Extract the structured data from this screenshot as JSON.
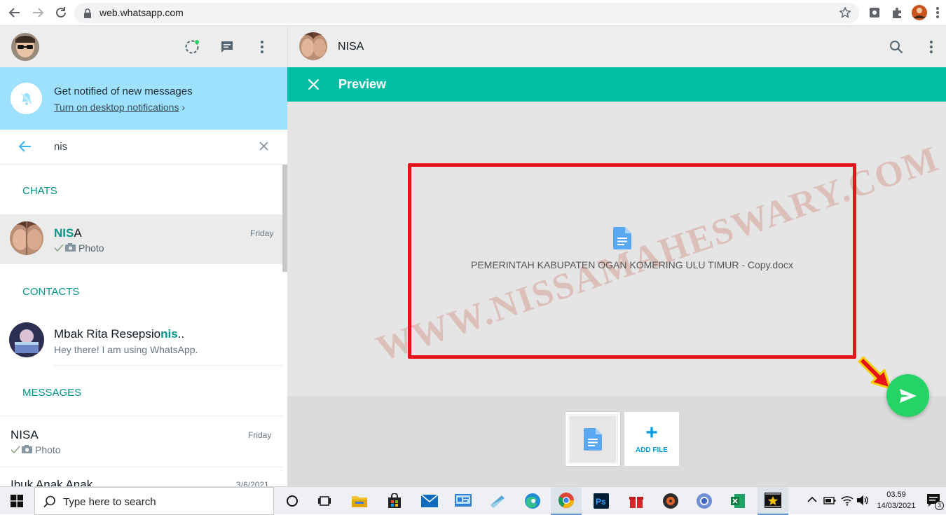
{
  "browser": {
    "url": "web.whatsapp.com"
  },
  "left_panel": {
    "notification": {
      "title": "Get notified of new messages",
      "link": "Turn on desktop notifications",
      "chevron": "›"
    },
    "search": {
      "query": "nis"
    },
    "sections": {
      "chats": "CHATS",
      "contacts": "CONTACTS",
      "messages": "MESSAGES"
    },
    "chat_result": {
      "name_match": "NIS",
      "name_rest": "A",
      "time": "Friday",
      "preview": "Photo"
    },
    "contact_result": {
      "name_prefix": "Mbak Rita Resepsio",
      "name_match": "nis",
      "name_suffix": "..",
      "status": "Hey there! I am using WhatsApp."
    },
    "message_results": [
      {
        "name": "NISA",
        "time": "Friday",
        "preview": "Photo"
      },
      {
        "name": "Ibuk Anak Anak",
        "time": "3/6/2021"
      }
    ]
  },
  "right_panel": {
    "header": {
      "contact_name": "NISA"
    },
    "preview": {
      "title": "Preview",
      "document_name": "PEMERINTAH KABUPATEN OGAN KOMERING ULU TIMUR - Copy.docx",
      "add_file_plus": "+",
      "add_file_label": "ADD FILE"
    },
    "watermark": "WWW.NISSAMAHESWARY.COM"
  },
  "taskbar": {
    "search_placeholder": "Type here to search",
    "time": "03.59",
    "date": "14/03/2021",
    "notification_count": "3"
  },
  "colors": {
    "whatsapp_teal": "#00bfa5",
    "send_green": "#25d366",
    "banner_blue": "#9de1fe",
    "highlight_red": "#e8121a"
  }
}
